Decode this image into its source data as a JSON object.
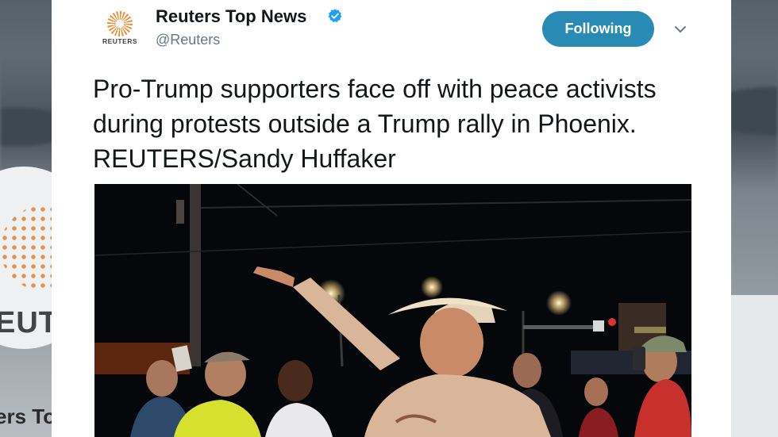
{
  "background": {
    "profile_logo_text": "EUT",
    "profile_name_text": "ers To"
  },
  "tweet": {
    "logo_text": "REUTERS",
    "display_name": "Reuters Top News",
    "verified": true,
    "handle": "@Reuters",
    "follow_label": "Following",
    "text": "Pro-Trump supporters face off with peace activists during protests outside a Trump rally in Phoenix. REUTERS/Sandy Huffaker"
  },
  "icons": {
    "verified": "verified-badge-icon",
    "menu": "chevron-down-icon",
    "logo": "reuters-logo-icon"
  },
  "colors": {
    "follow_button": "#2a8ab6",
    "verified": "#1da1f2",
    "reuters_orange": "#f08a2c",
    "text": "#14171a",
    "muted": "#657786"
  }
}
